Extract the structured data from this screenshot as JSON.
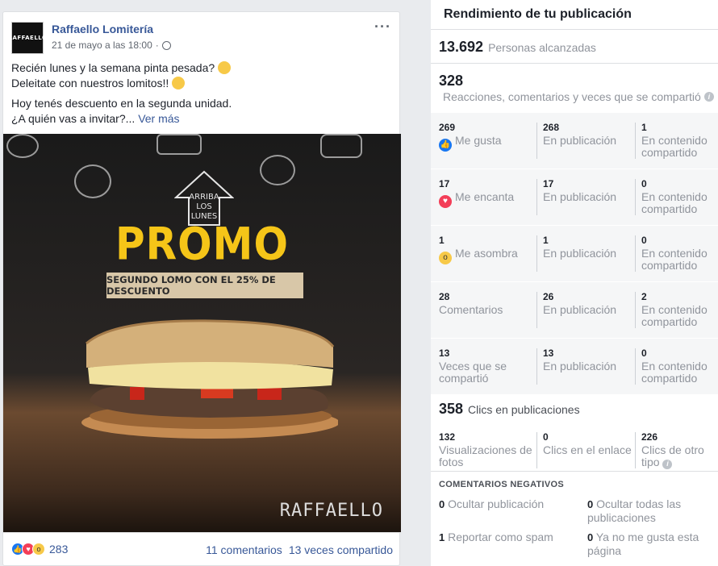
{
  "post": {
    "page_name": "Raffaello Lomitería",
    "avatar_text": "RAFFAELLO",
    "date": "21 de mayo a las 18:00",
    "line1": "Recién lunes y la semana pinta pesada?",
    "line2": "Deleitate con nuestros lomitos!!",
    "line3": "Hoy tenés descuento en la segunda unidad.",
    "line4": "¿A quién vas a invitar?...",
    "see_more": "Ver más",
    "image": {
      "arrow_text": [
        "ARRIBA",
        "LOS",
        "LUNES"
      ],
      "promo": "PROMO",
      "banner": "SEGUNDO LOMO CON EL 25% DE DESCUENTO",
      "brand": "RAFFAELLO"
    },
    "reaction_count": "283",
    "comments_link": "11 comentarios",
    "shares_link": "13 veces compartido"
  },
  "panel": {
    "title": "Rendimiento de tu publicación",
    "reach_num": "13.692",
    "reach_label": "Personas alcanzadas",
    "engage_num": "328",
    "engage_label": "Reacciones, comentarios y veces que se compartió",
    "rows": [
      {
        "total": "269",
        "label": "Me gusta",
        "post": "268",
        "post_label": "En publicación",
        "shared": "1",
        "shared_label": "En contenido compartido"
      },
      {
        "total": "17",
        "label": "Me encanta",
        "post": "17",
        "post_label": "En publicación",
        "shared": "0",
        "shared_label": "En contenido compartido"
      },
      {
        "total": "1",
        "label": "Me asombra",
        "post": "1",
        "post_label": "En publicación",
        "shared": "0",
        "shared_label": "En contenido compartido"
      },
      {
        "total": "28",
        "label": "Comentarios",
        "post": "26",
        "post_label": "En publicación",
        "shared": "2",
        "shared_label": "En contenido compartido"
      },
      {
        "total": "13",
        "label": "Veces que se compartió",
        "post": "13",
        "post_label": "En publicación",
        "shared": "0",
        "shared_label": "En contenido compartido"
      }
    ],
    "clicks_num": "358",
    "clicks_label": "Clics en publicaciones",
    "clicks": [
      {
        "n": "132",
        "label": "Visualizaciones de fotos"
      },
      {
        "n": "0",
        "label": "Clics en el enlace"
      },
      {
        "n": "226",
        "label": "Clics de otro tipo"
      }
    ],
    "negative_title": "COMENTARIOS NEGATIVOS",
    "negative": [
      {
        "n": "0",
        "label": "Ocultar publicación"
      },
      {
        "n": "0",
        "label": "Ocultar todas las publicaciones"
      },
      {
        "n": "1",
        "label": "Reportar como spam"
      },
      {
        "n": "0",
        "label": "Ya no me gusta esta página"
      }
    ]
  },
  "colors": {
    "link": "#385898",
    "like": "#1877f2",
    "love": "#f33e58",
    "wow": "#f7c948",
    "promo": "#f5c518"
  }
}
